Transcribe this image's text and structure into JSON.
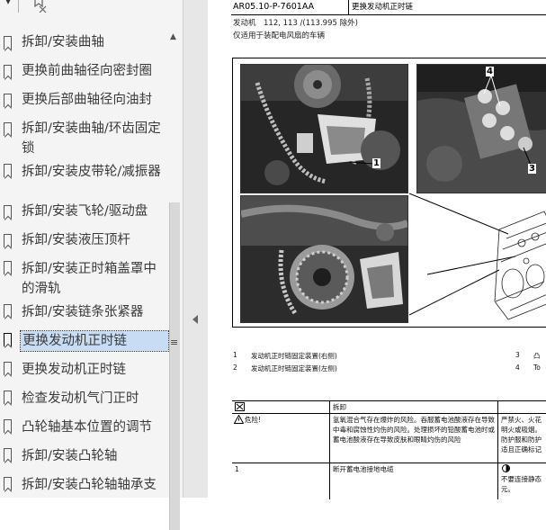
{
  "bookmarks": {
    "items": [
      {
        "label": "拆卸/安装曲轴",
        "selected": false
      },
      {
        "label": "更换前曲轴径向密封圈",
        "selected": false
      },
      {
        "label": "更换后部曲轴径向油封",
        "selected": false
      },
      {
        "label": "拆卸/安装曲轴/环齿固定锁",
        "selected": false
      },
      {
        "label": "拆卸/安装皮带轮/减振器",
        "selected": false
      },
      {
        "label": "拆卸/安装飞轮/驱动盘",
        "selected": false
      },
      {
        "label": "拆卸/安装液压顶杆",
        "selected": false
      },
      {
        "label": "拆卸/安装正时箱盖罩中的滑轨",
        "selected": false
      },
      {
        "label": "拆卸/安装链条张紧器",
        "selected": false
      },
      {
        "label": "更换发动机正时链",
        "selected": true
      },
      {
        "label": "更换发动机正时链",
        "selected": false
      },
      {
        "label": "检查发动机气门正时",
        "selected": false
      },
      {
        "label": "凸轮轴基本位置的调节",
        "selected": false
      },
      {
        "label": "拆卸/安装凸轮轴",
        "selected": false
      },
      {
        "label": "拆卸/安装凸轮轴轴承支",
        "selected": false
      }
    ]
  },
  "document": {
    "code": "AR05.10-P-7601AA",
    "title": "更换发动机正时链",
    "engine_line": "发动机　112, 113 /(113.995 除外)",
    "applicability": "仅适用于装配电风扇的车辆",
    "callouts": {
      "c1": "1",
      "c4": "4",
      "c3": "3"
    },
    "legend": [
      {
        "num": "1",
        "text": "发动机正时链固定装置(右侧)"
      },
      {
        "num": "2",
        "text": "发动机正时链固定装置(左侧)"
      },
      {
        "num": "3",
        "text": "凸"
      },
      {
        "num": "4",
        "text": "To"
      }
    ],
    "table": {
      "header": {
        "col2": "拆卸",
        "col3": ""
      },
      "danger_label": "危险!",
      "danger_text": "氢氧混合气存在爆炸的风险。吞服蓄电池酸液存在导致中毒和腐蚀性灼伤的风险。处理损坏的铅酸蓄电池时或蓄电池酸液存在导致皮肤和眼睛灼伤的风险",
      "danger_col3": "严禁火、火花明火或吸烟。防护服和防护适且正确标记",
      "step1_num": "1",
      "step1_text": "断开蓄电池接地电缆",
      "step1_note": "不要连接静态元。"
    }
  }
}
